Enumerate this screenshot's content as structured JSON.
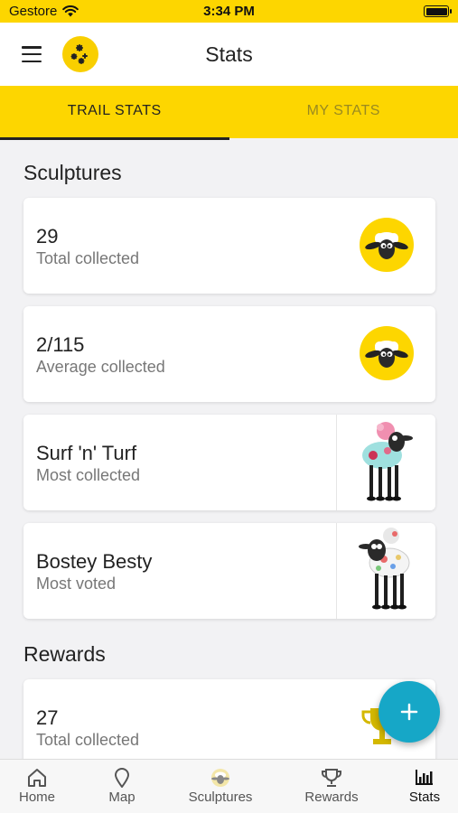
{
  "status": {
    "carrier": "Gestore",
    "time": "3:34 PM"
  },
  "header": {
    "title": "Stats"
  },
  "tabs": [
    {
      "label": "TRAIL STATS",
      "active": true
    },
    {
      "label": "MY STATS",
      "active": false
    }
  ],
  "sculptures": {
    "title": "Sculptures",
    "cards": [
      {
        "value": "29",
        "label": "Total collected",
        "image": "sheep-face-icon"
      },
      {
        "value": "2/115",
        "label": "Average collected",
        "image": "sheep-face-icon"
      },
      {
        "value": "Surf 'n' Turf",
        "label": "Most collected",
        "image": "sculpture-photo"
      },
      {
        "value": "Bostey Besty",
        "label": "Most voted",
        "image": "sculpture-photo"
      }
    ]
  },
  "rewards": {
    "title": "Rewards",
    "cards": [
      {
        "value": "27",
        "label": "Total collected",
        "image": "trophy-icon"
      }
    ]
  },
  "fab": {
    "icon": "plus-icon"
  },
  "bottom_nav": [
    {
      "label": "Home",
      "icon": "home-icon"
    },
    {
      "label": "Map",
      "icon": "map-pin-icon"
    },
    {
      "label": "Sculptures",
      "icon": "sheep-icon"
    },
    {
      "label": "Rewards",
      "icon": "trophy-icon"
    },
    {
      "label": "Stats",
      "icon": "bar-chart-icon",
      "active": true
    }
  ],
  "colors": {
    "brand_yellow": "#fdd600",
    "fab": "#16a7c7",
    "trophy": "#d4b800"
  }
}
